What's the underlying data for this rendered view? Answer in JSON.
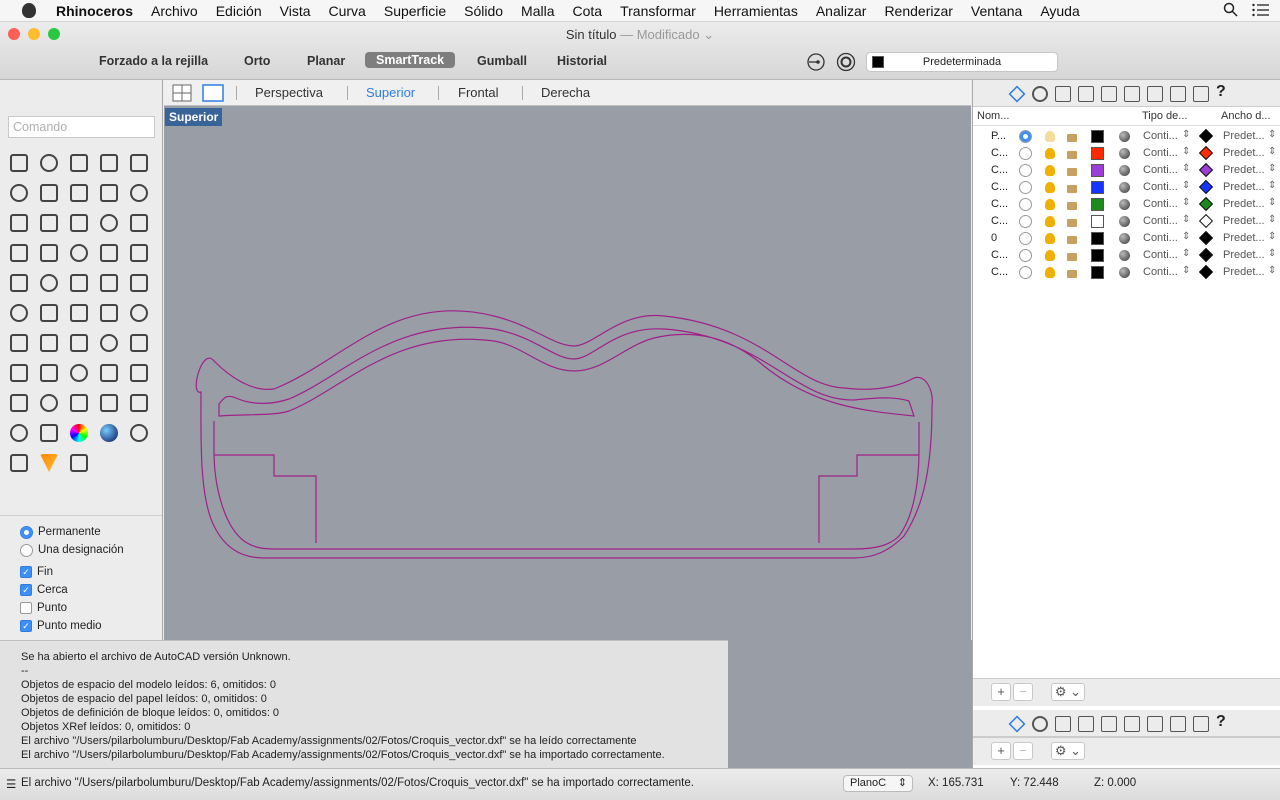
{
  "menubar": {
    "app": "Rhinoceros",
    "items": [
      "Archivo",
      "Edición",
      "Vista",
      "Curva",
      "Superficie",
      "Sólido",
      "Malla",
      "Cota",
      "Transformar",
      "Herramientas",
      "Analizar",
      "Renderizar",
      "Ventana",
      "Ayuda"
    ]
  },
  "window": {
    "title": "Sin título",
    "modified": "— Modificado"
  },
  "toolbar": {
    "grid_snap": "Forzado a la rejilla",
    "ortho": "Orto",
    "planar": "Planar",
    "smarttrack": "SmartTrack",
    "gumball": "Gumball",
    "history": "Historial",
    "current_layer": "Predeterminada"
  },
  "command": {
    "placeholder": "Comando"
  },
  "viewport_tabs": [
    "Perspectiva",
    "Superior",
    "Frontal",
    "Derecha"
  ],
  "active_viewport": "Superior",
  "osnap": {
    "permanent": "Permanente",
    "one_time": "Una designación",
    "items": [
      {
        "label": "Fin",
        "checked": true
      },
      {
        "label": "Cerca",
        "checked": true
      },
      {
        "label": "Punto",
        "checked": false
      },
      {
        "label": "Punto medio",
        "checked": true
      }
    ]
  },
  "history": [
    "Se ha abierto el archivo de AutoCAD versión Unknown.",
    "--",
    "Objetos de espacio del modelo leídos: 6, omitidos: 0",
    "Objetos de espacio del papel leídos: 0, omitidos: 0",
    "Objetos de definición de bloque leídos: 0, omitidos: 0",
    "Objetos XRef leídos: 0, omitidos: 0",
    "El archivo \"/Users/pilarbolumburu/Desktop/Fab Academy/assignments/02/Fotos/Croquis_vector.dxf\" se ha leído correctamente",
    "El archivo \"/Users/pilarbolumburu/Desktop/Fab Academy/assignments/02/Fotos/Croquis_vector.dxf\" se ha importado correctamente."
  ],
  "layers": {
    "headers": {
      "name": "Nom...",
      "linetype": "Tipo de...",
      "width": "Ancho d..."
    },
    "rows": [
      {
        "name": "P...",
        "current": true,
        "color": "#000000",
        "linetype": "Conti...",
        "width": "Predet..."
      },
      {
        "name": "C...",
        "current": false,
        "color": "#ff2a00",
        "linetype": "Conti...",
        "width": "Predet..."
      },
      {
        "name": "C...",
        "current": false,
        "color": "#9b3dd6",
        "linetype": "Conti...",
        "width": "Predet..."
      },
      {
        "name": "C...",
        "current": false,
        "color": "#1535ff",
        "linetype": "Conti...",
        "width": "Predet..."
      },
      {
        "name": "C...",
        "current": false,
        "color": "#1c8a1c",
        "linetype": "Conti...",
        "width": "Predet..."
      },
      {
        "name": "C...",
        "current": false,
        "color": "#ffffff",
        "linetype": "Conti...",
        "width": "Predet..."
      },
      {
        "name": "0",
        "current": false,
        "color": "#000000",
        "linetype": "Conti...",
        "width": "Predet..."
      },
      {
        "name": "C...",
        "current": false,
        "color": "#000000",
        "linetype": "Conti...",
        "width": "Predet..."
      },
      {
        "name": "C...",
        "current": false,
        "color": "#000000",
        "linetype": "Conti...",
        "width": "Predet..."
      }
    ]
  },
  "status": {
    "message": "El archivo \"/Users/pilarbolumburu/Desktop/Fab Academy/assignments/02/Fotos/Croquis_vector.dxf\" se ha importado correctamente.",
    "cplane": "PlanoC",
    "x": "X: 165.731",
    "y": "Y: 72.448",
    "z": "Z: 0.000"
  },
  "curve_color": "#a0208a"
}
